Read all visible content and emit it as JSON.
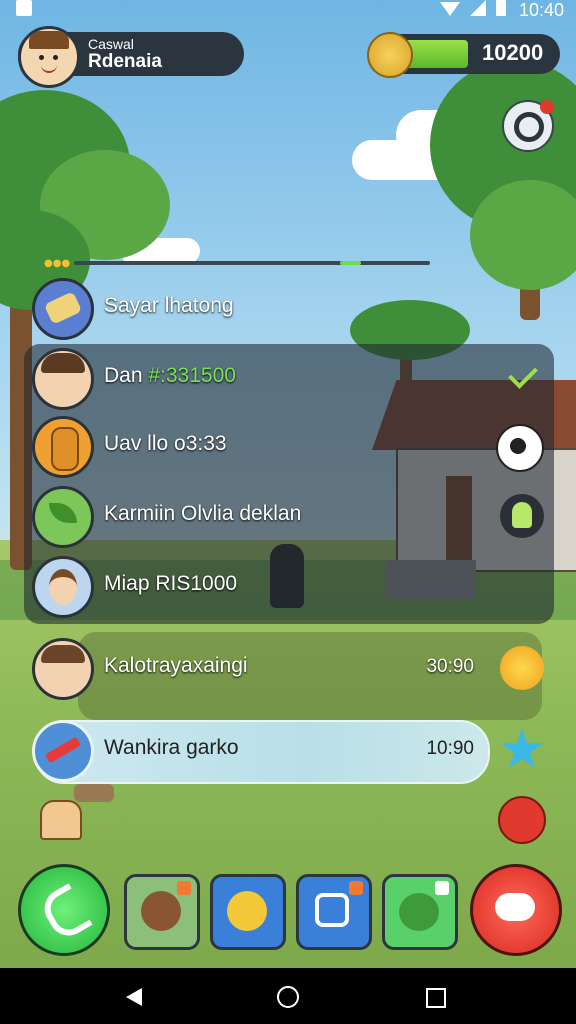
{
  "status_bar": {
    "time": "10:40"
  },
  "player": {
    "line1": "Caswal",
    "line2": "Rdenaia"
  },
  "score": {
    "value": "10200",
    "fill_fraction": 0.45
  },
  "progress": {
    "fill_fraction": 0.06
  },
  "list": [
    {
      "label": "Sayar lhatong",
      "time": "",
      "avatar": "sandwich-icon",
      "action": ""
    },
    {
      "label_prefix": "Dan ",
      "label_highlight": "#:331500",
      "time": "",
      "avatar": "boy-avatar",
      "action": "checkmark-icon"
    },
    {
      "label": "Uav llo o3:33",
      "time": "",
      "avatar": "giraffe-avatar",
      "action": "gear-icon"
    },
    {
      "label": "Karmiin Olvlia deklan",
      "time": "",
      "avatar": "leaf-icon",
      "action": "ghost-icon"
    },
    {
      "label": "Miap RIS1000",
      "time": "",
      "avatar": "girl-avatar",
      "action": ""
    },
    {
      "label": "Kalotrayaxaingi",
      "time": "30:90",
      "avatar": "boy-avatar",
      "action": "sun-icon"
    },
    {
      "label": "Wankira garko",
      "time": "10:90",
      "avatar": "pencil-icon",
      "action": "star-icon"
    }
  ],
  "bottom_bar": [
    "phone-icon",
    "bear-icon",
    "emoji-icon",
    "camera-icon",
    "monster-icon",
    "chat-icon"
  ],
  "colors": {
    "accent_green": "#6fdc4e",
    "call": "#23b53a",
    "chat": "#d8281e"
  }
}
